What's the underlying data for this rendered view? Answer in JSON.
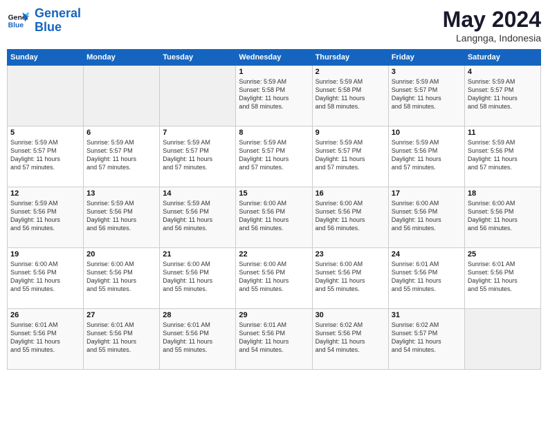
{
  "logo": {
    "line1": "General",
    "line2": "Blue"
  },
  "title": "May 2024",
  "subtitle": "Langnga, Indonesia",
  "days_of_week": [
    "Sunday",
    "Monday",
    "Tuesday",
    "Wednesday",
    "Thursday",
    "Friday",
    "Saturday"
  ],
  "weeks": [
    [
      {
        "day": "",
        "info": ""
      },
      {
        "day": "",
        "info": ""
      },
      {
        "day": "",
        "info": ""
      },
      {
        "day": "1",
        "info": "Sunrise: 5:59 AM\nSunset: 5:58 PM\nDaylight: 11 hours\nand 58 minutes."
      },
      {
        "day": "2",
        "info": "Sunrise: 5:59 AM\nSunset: 5:58 PM\nDaylight: 11 hours\nand 58 minutes."
      },
      {
        "day": "3",
        "info": "Sunrise: 5:59 AM\nSunset: 5:57 PM\nDaylight: 11 hours\nand 58 minutes."
      },
      {
        "day": "4",
        "info": "Sunrise: 5:59 AM\nSunset: 5:57 PM\nDaylight: 11 hours\nand 58 minutes."
      }
    ],
    [
      {
        "day": "5",
        "info": "Sunrise: 5:59 AM\nSunset: 5:57 PM\nDaylight: 11 hours\nand 57 minutes."
      },
      {
        "day": "6",
        "info": "Sunrise: 5:59 AM\nSunset: 5:57 PM\nDaylight: 11 hours\nand 57 minutes."
      },
      {
        "day": "7",
        "info": "Sunrise: 5:59 AM\nSunset: 5:57 PM\nDaylight: 11 hours\nand 57 minutes."
      },
      {
        "day": "8",
        "info": "Sunrise: 5:59 AM\nSunset: 5:57 PM\nDaylight: 11 hours\nand 57 minutes."
      },
      {
        "day": "9",
        "info": "Sunrise: 5:59 AM\nSunset: 5:57 PM\nDaylight: 11 hours\nand 57 minutes."
      },
      {
        "day": "10",
        "info": "Sunrise: 5:59 AM\nSunset: 5:56 PM\nDaylight: 11 hours\nand 57 minutes."
      },
      {
        "day": "11",
        "info": "Sunrise: 5:59 AM\nSunset: 5:56 PM\nDaylight: 11 hours\nand 57 minutes."
      }
    ],
    [
      {
        "day": "12",
        "info": "Sunrise: 5:59 AM\nSunset: 5:56 PM\nDaylight: 11 hours\nand 56 minutes."
      },
      {
        "day": "13",
        "info": "Sunrise: 5:59 AM\nSunset: 5:56 PM\nDaylight: 11 hours\nand 56 minutes."
      },
      {
        "day": "14",
        "info": "Sunrise: 5:59 AM\nSunset: 5:56 PM\nDaylight: 11 hours\nand 56 minutes."
      },
      {
        "day": "15",
        "info": "Sunrise: 6:00 AM\nSunset: 5:56 PM\nDaylight: 11 hours\nand 56 minutes."
      },
      {
        "day": "16",
        "info": "Sunrise: 6:00 AM\nSunset: 5:56 PM\nDaylight: 11 hours\nand 56 minutes."
      },
      {
        "day": "17",
        "info": "Sunrise: 6:00 AM\nSunset: 5:56 PM\nDaylight: 11 hours\nand 56 minutes."
      },
      {
        "day": "18",
        "info": "Sunrise: 6:00 AM\nSunset: 5:56 PM\nDaylight: 11 hours\nand 56 minutes."
      }
    ],
    [
      {
        "day": "19",
        "info": "Sunrise: 6:00 AM\nSunset: 5:56 PM\nDaylight: 11 hours\nand 55 minutes."
      },
      {
        "day": "20",
        "info": "Sunrise: 6:00 AM\nSunset: 5:56 PM\nDaylight: 11 hours\nand 55 minutes."
      },
      {
        "day": "21",
        "info": "Sunrise: 6:00 AM\nSunset: 5:56 PM\nDaylight: 11 hours\nand 55 minutes."
      },
      {
        "day": "22",
        "info": "Sunrise: 6:00 AM\nSunset: 5:56 PM\nDaylight: 11 hours\nand 55 minutes."
      },
      {
        "day": "23",
        "info": "Sunrise: 6:00 AM\nSunset: 5:56 PM\nDaylight: 11 hours\nand 55 minutes."
      },
      {
        "day": "24",
        "info": "Sunrise: 6:01 AM\nSunset: 5:56 PM\nDaylight: 11 hours\nand 55 minutes."
      },
      {
        "day": "25",
        "info": "Sunrise: 6:01 AM\nSunset: 5:56 PM\nDaylight: 11 hours\nand 55 minutes."
      }
    ],
    [
      {
        "day": "26",
        "info": "Sunrise: 6:01 AM\nSunset: 5:56 PM\nDaylight: 11 hours\nand 55 minutes."
      },
      {
        "day": "27",
        "info": "Sunrise: 6:01 AM\nSunset: 5:56 PM\nDaylight: 11 hours\nand 55 minutes."
      },
      {
        "day": "28",
        "info": "Sunrise: 6:01 AM\nSunset: 5:56 PM\nDaylight: 11 hours\nand 55 minutes."
      },
      {
        "day": "29",
        "info": "Sunrise: 6:01 AM\nSunset: 5:56 PM\nDaylight: 11 hours\nand 54 minutes."
      },
      {
        "day": "30",
        "info": "Sunrise: 6:02 AM\nSunset: 5:56 PM\nDaylight: 11 hours\nand 54 minutes."
      },
      {
        "day": "31",
        "info": "Sunrise: 6:02 AM\nSunset: 5:57 PM\nDaylight: 11 hours\nand 54 minutes."
      },
      {
        "day": "",
        "info": ""
      }
    ]
  ]
}
